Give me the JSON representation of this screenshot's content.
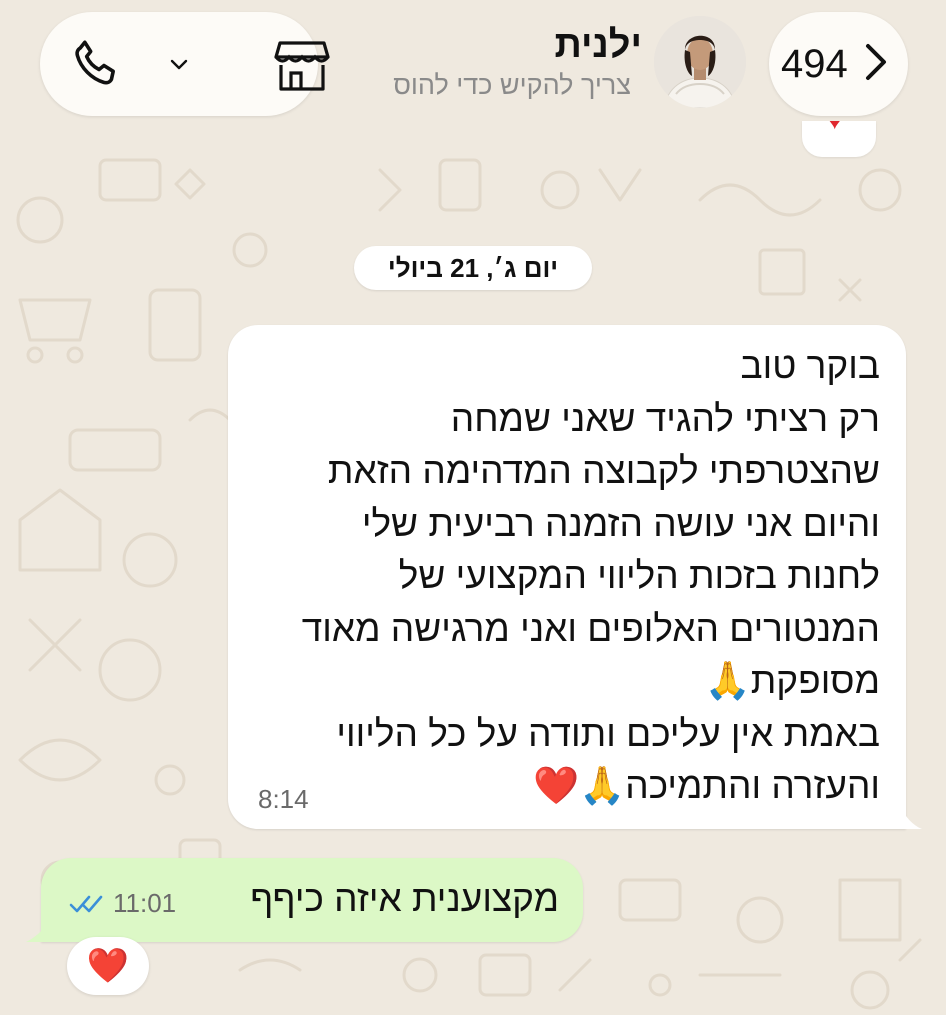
{
  "header": {
    "title": "ילנית",
    "subtitle": "צריך להקיש כדי להוס",
    "unread_count": "494",
    "icons": {
      "back": "chevron-left-icon",
      "call": "phone-icon",
      "call_menu": "chevron-down-icon",
      "shop": "storefront-icon",
      "avatar": "contact-avatar"
    }
  },
  "date_separator": "יום ג׳, 21 ביולי",
  "messages": {
    "incoming": {
      "lines": [
        "בוקר טוב",
        "רק רציתי להגיד שאני שמחה",
        "שהצטרפתי לקבוצה המדהימה הזאת",
        "והיום אני עושה הזמנה רביעית שלי",
        "לחנות בזכות הליווי המקצועי של",
        "המנטורים האלופים ואני מרגישה מאוד",
        "מסופקת🙏",
        "באמת אין עליכם ותודה על כל הליווי",
        "והעזרה והתמיכה🙏❤️"
      ],
      "time": "8:14",
      "reaction": "❤️"
    },
    "outgoing": {
      "text": "מקצוענית איזה כיףף",
      "time": "11:01",
      "status": "read",
      "reaction": "❤️"
    }
  },
  "colors": {
    "wallpaper": "#efe9df",
    "incoming_bubble": "#ffffff",
    "outgoing_bubble": "#dcf8c6",
    "read_ticks": "#3b8fd8",
    "heart": "#e0282e"
  }
}
